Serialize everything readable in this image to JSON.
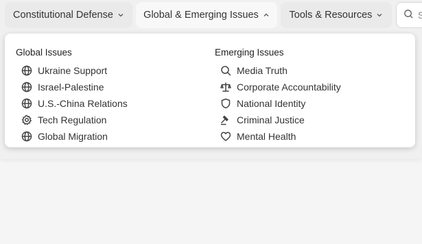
{
  "nav": {
    "constitutional": "Constitutional Defense",
    "global": "Global & Emerging Issues",
    "tools": "Tools & Resources",
    "search_placeholder": "S"
  },
  "dropdown": {
    "global_title": "Global Issues",
    "global_items": [
      {
        "label": "Ukraine Support",
        "icon": "globe-icon"
      },
      {
        "label": "Israel-Palestine",
        "icon": "globe-icon"
      },
      {
        "label": "U.S.-China Relations",
        "icon": "globe-icon"
      },
      {
        "label": "Tech Regulation",
        "icon": "gear-icon"
      },
      {
        "label": "Global Migration",
        "icon": "globe-icon"
      }
    ],
    "emerging_title": "Emerging Issues",
    "emerging_items": [
      {
        "label": "Media Truth",
        "icon": "search-icon"
      },
      {
        "label": "Corporate Accountability",
        "icon": "scale-icon"
      },
      {
        "label": "National Identity",
        "icon": "shield-icon"
      },
      {
        "label": "Criminal Justice",
        "icon": "gavel-icon"
      },
      {
        "label": "Mental Health",
        "icon": "heart-icon"
      }
    ]
  }
}
